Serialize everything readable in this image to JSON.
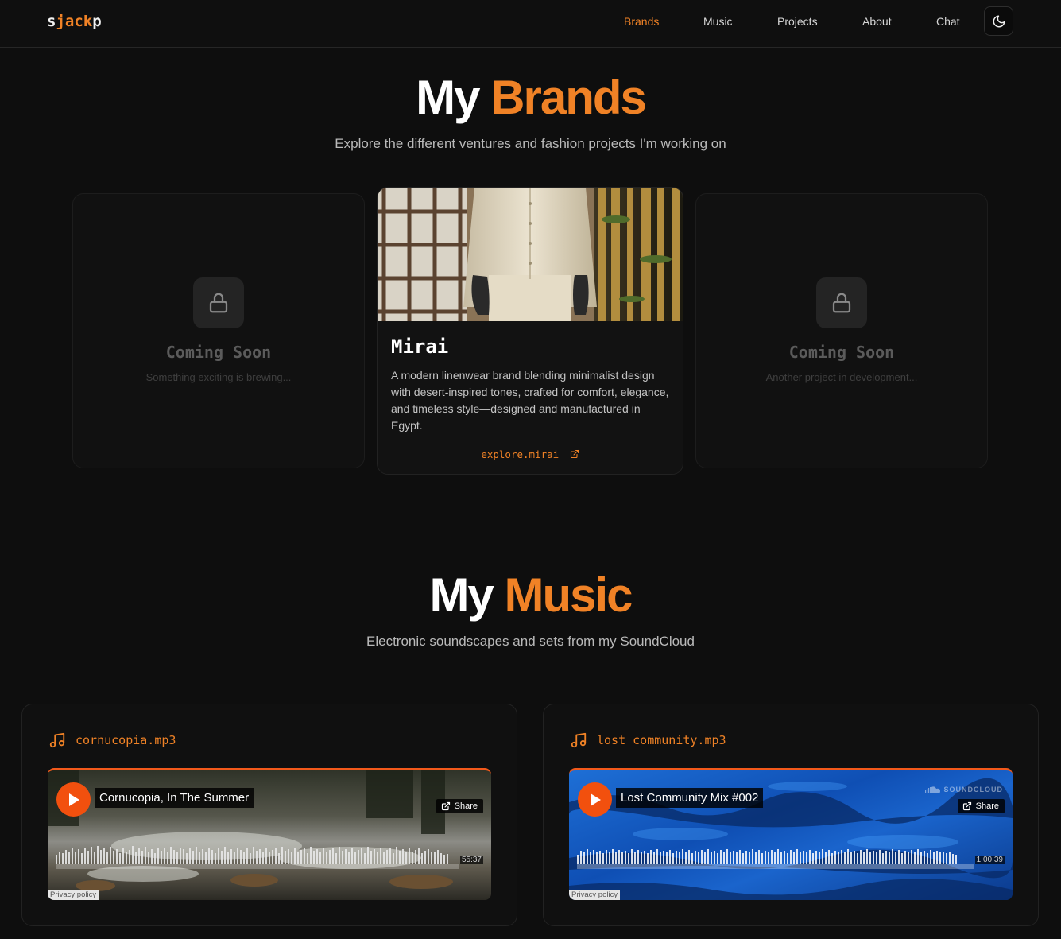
{
  "nav": {
    "logo": {
      "part1": "s",
      "accent": "jack",
      "part2": "p"
    },
    "links": [
      "Brands",
      "Music",
      "Projects",
      "About",
      "Chat"
    ],
    "active": "Brands",
    "theme_icon": "moon-icon"
  },
  "brands": {
    "title_plain": "My",
    "title_accent": "Brands",
    "subtitle": "Explore the different ventures and fashion projects I'm working on",
    "cards": [
      {
        "title": "Coming Soon",
        "subtitle": "Something exciting is brewing...",
        "icon": "lock-icon"
      },
      {
        "name": "Mirai",
        "description": "A modern linenwear brand blending minimalist design with desert-inspired tones, crafted for comfort, elegance, and timeless style—designed and manufactured in Egypt.",
        "link": "explore.mirai",
        "link_icon": "external-link-icon"
      },
      {
        "title": "Coming Soon",
        "subtitle": "Another project in development...",
        "icon": "lock-icon"
      }
    ]
  },
  "music": {
    "title_plain": "My",
    "title_accent": "Music",
    "subtitle": "Electronic soundscapes and sets from my SoundCloud",
    "tracks": [
      {
        "file": "cornucopia.mp3",
        "title": "Cornucopia, In The Summer",
        "duration": "55:37",
        "share": "Share",
        "privacy": "Privacy policy"
      },
      {
        "file": "lost_community.mp3",
        "title": "Lost Community Mix #002",
        "duration": "1:00:39",
        "share": "Share",
        "privacy": "Privacy policy",
        "brand": "SOUNDCLOUD"
      }
    ]
  },
  "colors": {
    "accent": "#f08226",
    "soundcloud": "#f2500e",
    "background": "#0e0e0e"
  }
}
